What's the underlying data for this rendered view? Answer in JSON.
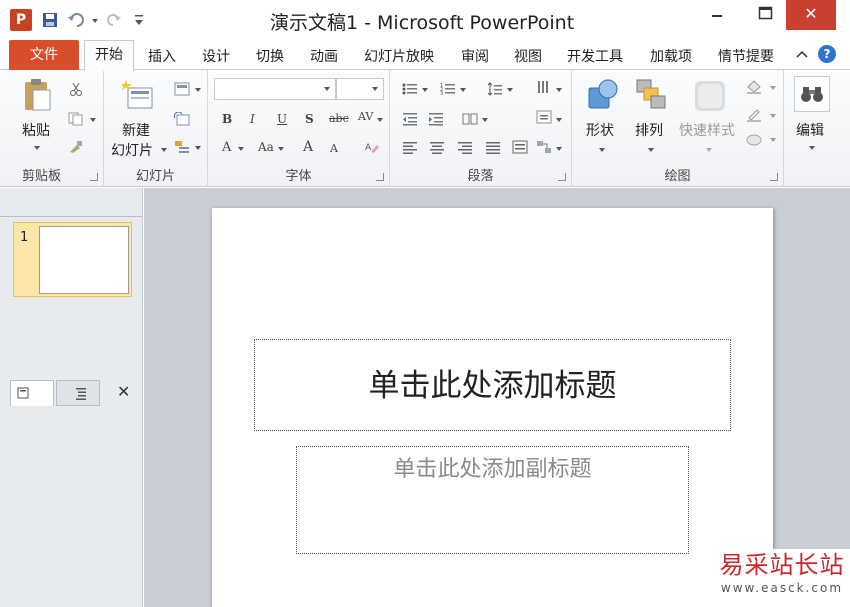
{
  "window": {
    "title": "演示文稿1 - Microsoft PowerPoint",
    "app_icon_letter": "P",
    "minimize_symbol": "▭",
    "close_symbol": "✕"
  },
  "tabs": {
    "file": "文件",
    "home": "开始",
    "items": [
      "插入",
      "设计",
      "切换",
      "动画",
      "幻灯片放映",
      "审阅",
      "视图",
      "开发工具",
      "加载项",
      "情节提要"
    ]
  },
  "ribbon": {
    "clipboard": {
      "paste": "粘贴",
      "label": "剪贴板"
    },
    "slides": {
      "new_line1": "新建",
      "new_line2": "幻灯片",
      "label": "幻灯片"
    },
    "font": {
      "label": "字体",
      "bold": "B",
      "italic": "I",
      "underline": "U",
      "shadow": "S",
      "strike": "abc",
      "spacing": "AV",
      "font_color": "A",
      "case": "Aa",
      "grow": "A",
      "shrink": "A"
    },
    "paragraph": {
      "label": "段落"
    },
    "drawing": {
      "shapes": "形状",
      "arrange": "排列",
      "quick_styles": "快速样式",
      "label": "绘图"
    },
    "editing": {
      "label": "编辑"
    }
  },
  "panel": {
    "close_symbol": "✕",
    "slide_number": "1"
  },
  "slide": {
    "title_placeholder": "单击此处添加标题",
    "subtitle_placeholder": "单击此处添加副标题"
  },
  "watermark": {
    "text": "易采站长站",
    "url": "www.easck.com"
  }
}
